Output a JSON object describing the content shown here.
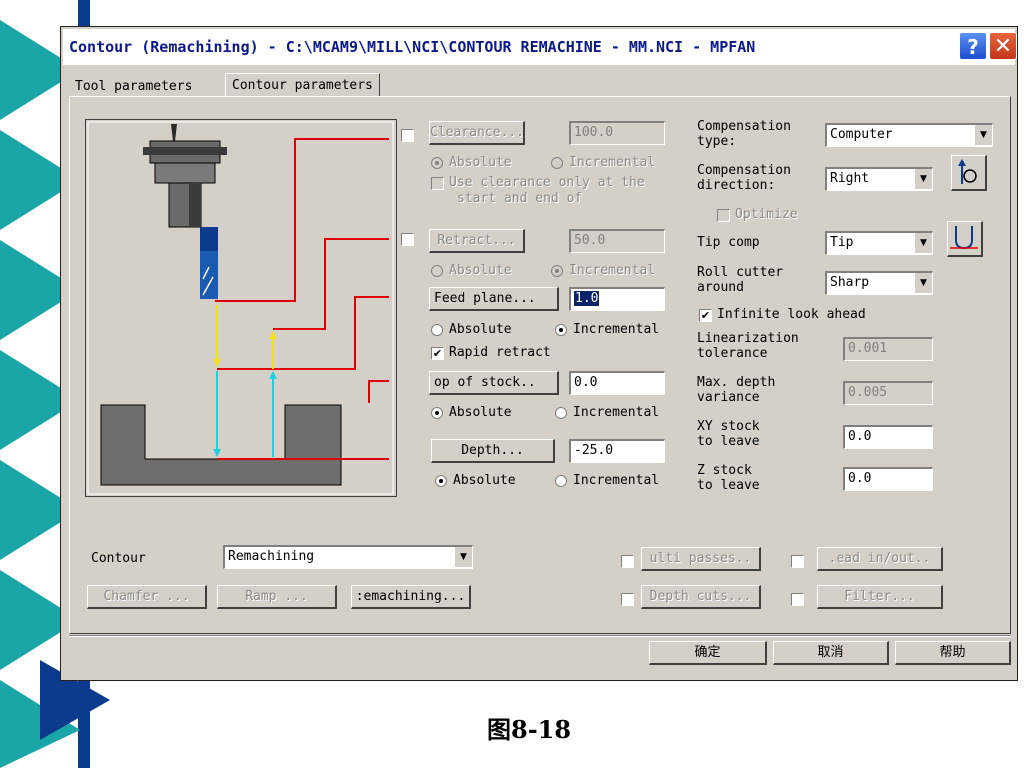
{
  "window": {
    "title": "Contour (Remachining) - C:\\MCAM9\\MILL\\NCI\\CONTOUR REMACHINE - MM.NCI - MPFAN",
    "help_label": "?",
    "close_label": "✕"
  },
  "tabs": [
    {
      "label": "Tool parameters"
    },
    {
      "label": "Contour parameters"
    }
  ],
  "params": {
    "clearance": {
      "button": "Clearance...",
      "value": "100.0",
      "checked": false
    },
    "clearance_mode": {
      "absolute": "Absolute",
      "incremental": "Incremental",
      "selected": "absolute"
    },
    "use_clearance": {
      "line1": "Use clearance only at the",
      "line2": "start and end of"
    },
    "retract": {
      "button": "Retract...",
      "value": "50.0",
      "checked": false
    },
    "retract_mode": {
      "absolute": "Absolute",
      "incremental": "Incremental",
      "selected": "incremental"
    },
    "feed_plane": {
      "button": "Feed plane...",
      "value": "1.0"
    },
    "feed_mode": {
      "absolute": "Absolute",
      "incremental": "Incremental",
      "selected": "incremental"
    },
    "rapid_retract": {
      "label": "Rapid retract",
      "checked": true
    },
    "top_of_stock": {
      "button": "op of stock..",
      "value": "0.0"
    },
    "top_mode": {
      "absolute": "Absolute",
      "incremental": "Incremental",
      "selected": "absolute"
    },
    "depth": {
      "button": "Depth...",
      "value": "-25.0"
    },
    "depth_mode": {
      "absolute": "Absolute",
      "incremental": "Incremental",
      "selected": "absolute"
    }
  },
  "compensation": {
    "type_label": "Compensation type:",
    "type_label_1": "Compensation",
    "type_label_2": "type:",
    "type_value": "Computer",
    "dir_label_1": "Compensation",
    "dir_label_2": "direction:",
    "dir_value": "Right",
    "optimize_label": "Optimize",
    "tip_label": "Tip comp",
    "tip_value": "Tip",
    "roll_label_1": "Roll cutter",
    "roll_label_2": "around",
    "roll_value": "Sharp",
    "infinite_label": "Infinite look ahead",
    "infinite_checked": true,
    "lin_label_1": "Linearization",
    "lin_label_2": "tolerance",
    "lin_value": "0.001",
    "maxdepth_label_1": "Max. depth",
    "maxdepth_label_2": "variance",
    "maxdepth_value": "0.005",
    "xy_label_1": "XY stock",
    "xy_label_2": "to leave",
    "xy_value": "0.0",
    "z_label_1": "Z stock",
    "z_label_2": "to leave",
    "z_value": "0.0"
  },
  "bottom": {
    "contour_label": "Contour",
    "contour_value": "Remachining",
    "chamfer": "Chamfer ...",
    "ramp": "Ramp ...",
    "remachining": ":emachining...",
    "multi_passes": "ulti passes..",
    "lead_in_out": ".ead in/out..",
    "depth_cuts": "Depth cuts...",
    "filter": "Filter..."
  },
  "dialog_buttons": {
    "ok": "确定",
    "cancel": "取消",
    "help": "帮助"
  },
  "caption": "图8-18",
  "colors": {
    "title_text": "#0a1a8a",
    "dialog_bg": "#d4d0c8",
    "deco_teal": "#1aa6a6",
    "deco_blue": "#0c3a8c"
  }
}
